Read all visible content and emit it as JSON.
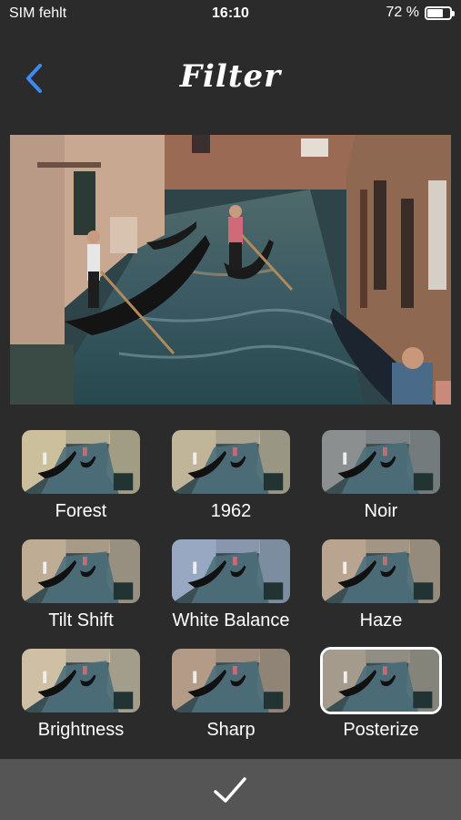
{
  "status_bar": {
    "carrier": "SIM fehlt",
    "time": "16:10",
    "battery": "72 %",
    "battery_level": 0.72
  },
  "nav": {
    "title": "Filter",
    "back_icon": "chevron-left-icon",
    "accent_color": "#3d8bf2"
  },
  "preview": {
    "filter": "Posterize"
  },
  "filters": [
    {
      "label": "Forest",
      "tone": "#e6d2a8"
    },
    {
      "label": "1962",
      "tone": "#d8c6a6"
    },
    {
      "label": "Noir",
      "tone": "#9a9a9a"
    },
    {
      "label": "Tilt Shift",
      "tone": "#d6bca0"
    },
    {
      "label": "White Balance",
      "tone": "#a9b7d6"
    },
    {
      "label": "Haze",
      "tone": "#d0b49a"
    },
    {
      "label": "Brightness",
      "tone": "#e9d2b4"
    },
    {
      "label": "Sharp",
      "tone": "#c9a890"
    },
    {
      "label": "Posterize",
      "tone": "#b8a898",
      "selected": true
    }
  ],
  "bottom_bar": {
    "confirm_icon": "checkmark-icon",
    "background": "#555555"
  }
}
